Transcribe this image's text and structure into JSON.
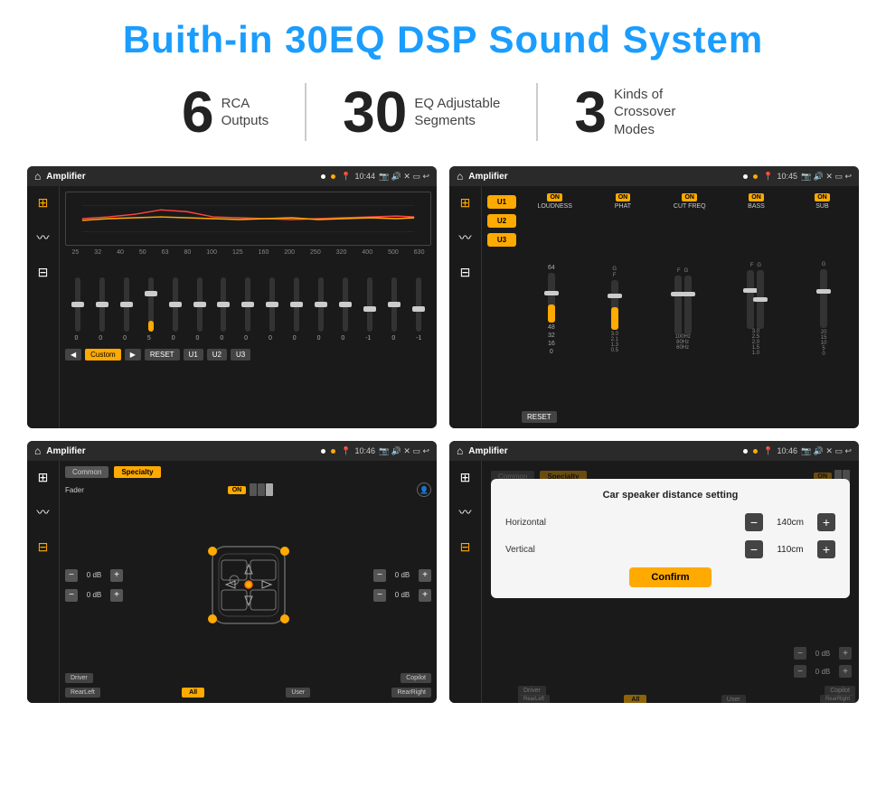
{
  "title": "Buith-in 30EQ DSP Sound System",
  "stats": [
    {
      "number": "6",
      "label_line1": "RCA",
      "label_line2": "Outputs"
    },
    {
      "number": "30",
      "label_line1": "EQ Adjustable",
      "label_line2": "Segments"
    },
    {
      "number": "3",
      "label_line1": "Kinds of",
      "label_line2": "Crossover Modes"
    }
  ],
  "screens": [
    {
      "id": "eq-screen",
      "status_bar": {
        "app": "Amplifier",
        "time": "10:44",
        "icons": "📷 🔊 ✗ ▭ ↩"
      }
    },
    {
      "id": "xover-screen",
      "status_bar": {
        "app": "Amplifier",
        "time": "10:45"
      }
    },
    {
      "id": "fader-screen",
      "status_bar": {
        "app": "Amplifier",
        "time": "10:46"
      },
      "tabs": [
        "Common",
        "Specialty"
      ],
      "fader_label": "Fader",
      "fader_on": "ON",
      "db_values": [
        "0 dB",
        "0 dB",
        "0 dB",
        "0 dB"
      ],
      "bottom_btns": [
        "Driver",
        "All",
        "User",
        "Copilot",
        "RearLeft",
        "RearRight"
      ]
    },
    {
      "id": "dist-screen",
      "status_bar": {
        "app": "Amplifier",
        "time": "10:46"
      },
      "dialog": {
        "title": "Car speaker distance setting",
        "rows": [
          {
            "label": "Horizontal",
            "value": "140cm"
          },
          {
            "label": "Vertical",
            "value": "110cm"
          }
        ],
        "confirm_label": "Confirm"
      }
    }
  ],
  "eq_labels": [
    "25",
    "32",
    "40",
    "50",
    "63",
    "80",
    "100",
    "125",
    "160",
    "200",
    "250",
    "320",
    "400",
    "500",
    "630"
  ],
  "eq_values": [
    "0",
    "0",
    "0",
    "5",
    "0",
    "0",
    "0",
    "0",
    "0",
    "0",
    "0",
    "0",
    "-1",
    "0",
    "-1"
  ],
  "xover_channels": [
    {
      "label": "LOUDNESS"
    },
    {
      "label": "PHAT"
    },
    {
      "label": "CUT FREQ"
    },
    {
      "label": "BASS"
    },
    {
      "label": "SUB"
    }
  ],
  "xover_presets": [
    "U1",
    "U2",
    "U3"
  ]
}
